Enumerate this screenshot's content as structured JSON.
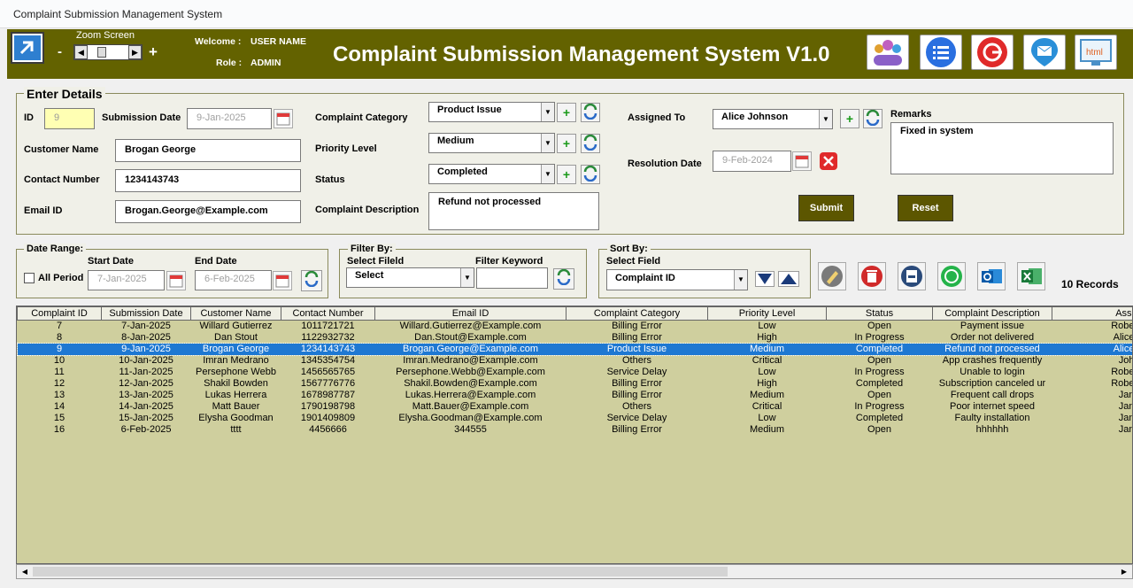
{
  "window": {
    "title": "Complaint Submission Management System"
  },
  "header": {
    "zoom_label": "Zoom Screen",
    "zoom_minus": "-",
    "zoom_plus": "+",
    "welcome_label": "Welcome :",
    "welcome_value": "USER NAME",
    "role_label": "Role :",
    "role_value": "ADMIN",
    "title": "Complaint Submission Management System V1.0",
    "buttons": [
      "users-icon",
      "list-icon",
      "logout-icon",
      "email-icon",
      "html-icon"
    ]
  },
  "details": {
    "legend": "Enter Details",
    "id_label": "ID",
    "id_value": "9",
    "submission_date_label": "Submission Date",
    "submission_date_value": "9-Jan-2025",
    "customer_name_label": "Customer Name",
    "customer_name_value": "Brogan George",
    "contact_number_label": "Contact Number",
    "contact_number_value": "1234143743",
    "email_label": "Email ID",
    "email_value": "Brogan.George@Example.com",
    "category_label": "Complaint Category",
    "category_value": "Product Issue",
    "priority_label": "Priority Level",
    "priority_value": "Medium",
    "status_label": "Status",
    "status_value": "Completed",
    "description_label": "Complaint Description",
    "description_value": "Refund not processed",
    "assigned_label": "Assigned To",
    "assigned_value": "Alice Johnson",
    "resolution_label": "Resolution Date",
    "resolution_value": "9-Feb-2024",
    "remarks_label": "Remarks",
    "remarks_value": "Fixed in system",
    "submit_label": "Submit",
    "reset_label": "Reset",
    "plus": "+"
  },
  "date_range": {
    "legend": "Date Range:",
    "all_period_label": "All Period",
    "start_label": "Start Date",
    "start_value": "7-Jan-2025",
    "end_label": "End Date",
    "end_value": "6-Feb-2025"
  },
  "filter": {
    "legend": "Filter By:",
    "field_label": "Select Fileld",
    "field_value": "Select",
    "keyword_label": "Filter Keyword"
  },
  "sort": {
    "legend": "Sort By:",
    "field_label": "Select Field",
    "field_value": "Complaint ID"
  },
  "records_label": "10 Records",
  "table": {
    "columns": [
      "Complaint ID",
      "Submission Date",
      "Customer Name",
      "Contact Number",
      "Email ID",
      "Complaint Category",
      "Priority Level",
      "Status",
      "Complaint Description",
      "Assi"
    ],
    "rows": [
      [
        "7",
        "7-Jan-2025",
        "Willard Gutierrez",
        "1011721721",
        "Willard.Gutierrez@Example.com",
        "Billing Error",
        "Low",
        "Open",
        "Payment issue",
        "Robe"
      ],
      [
        "8",
        "8-Jan-2025",
        "Dan Stout",
        "1122932732",
        "Dan.Stout@Example.com",
        "Billing Error",
        "High",
        "In Progress",
        "Order not delivered",
        "Alice"
      ],
      [
        "9",
        "9-Jan-2025",
        "Brogan George",
        "1234143743",
        "Brogan.George@Example.com",
        "Product Issue",
        "Medium",
        "Completed",
        "Refund not processed",
        "Alice"
      ],
      [
        "10",
        "10-Jan-2025",
        "Imran Medrano",
        "1345354754",
        "Imran.Medrano@Example.com",
        "Others",
        "Critical",
        "Open",
        "App crashes frequently",
        "Joh"
      ],
      [
        "11",
        "11-Jan-2025",
        "Persephone Webb",
        "1456565765",
        "Persephone.Webb@Example.com",
        "Service Delay",
        "Low",
        "In Progress",
        "Unable to login",
        "Robe"
      ],
      [
        "12",
        "12-Jan-2025",
        "Shakil Bowden",
        "1567776776",
        "Shakil.Bowden@Example.com",
        "Billing Error",
        "High",
        "Completed",
        "Subscription canceled ur",
        "Robe"
      ],
      [
        "13",
        "13-Jan-2025",
        "Lukas Herrera",
        "1678987787",
        "Lukas.Herrera@Example.com",
        "Billing Error",
        "Medium",
        "Open",
        "Frequent call drops",
        "Jan"
      ],
      [
        "14",
        "14-Jan-2025",
        "Matt Bauer",
        "1790198798",
        "Matt.Bauer@Example.com",
        "Others",
        "Critical",
        "In Progress",
        "Poor internet speed",
        "Jan"
      ],
      [
        "15",
        "15-Jan-2025",
        "Elysha Goodman",
        "1901409809",
        "Elysha.Goodman@Example.com",
        "Service Delay",
        "Low",
        "Completed",
        "Faulty installation",
        "Jan"
      ],
      [
        "16",
        "6-Feb-2025",
        "tttt",
        "4456666",
        "344555",
        "Billing Error",
        "Medium",
        "Open",
        "hhhhhh",
        "Jan"
      ]
    ],
    "selected_row": 2
  }
}
